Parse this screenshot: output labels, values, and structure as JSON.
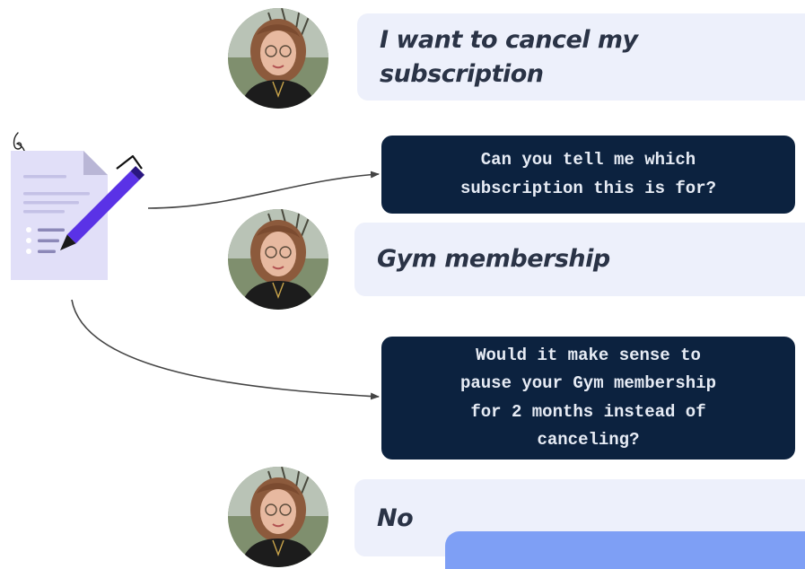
{
  "conversation": {
    "user_messages": [
      {
        "text": "I want to cancel my\nsubscription"
      },
      {
        "text": "Gym membership"
      },
      {
        "text": "No"
      }
    ],
    "bot_messages": [
      {
        "text": "Can you tell me which\nsubscription this is for?"
      },
      {
        "text": "Would it make sense to\npause your Gym membership\nfor 2 months instead of\ncanceling?"
      }
    ]
  },
  "colors": {
    "user_bubble": "#edf0fb",
    "bot_bubble": "#0c223f",
    "bot_text": "#e7ecf5",
    "user_text": "#2a3346",
    "accent_block": "#7e9ff5",
    "document": "#e1dff8",
    "pen": "#5a32e6",
    "connector": "#444444"
  },
  "icons": {
    "form": "form-with-pen-icon",
    "avatar": "user-avatar-icon"
  }
}
